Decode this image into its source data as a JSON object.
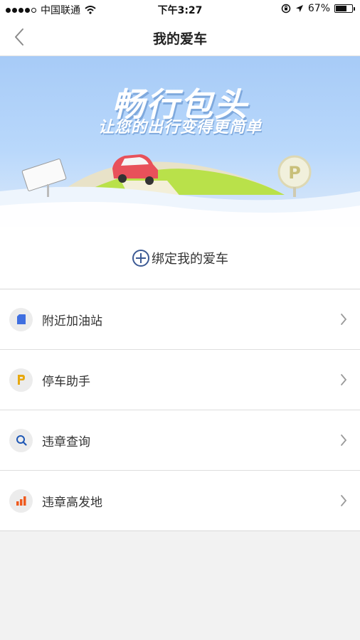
{
  "status_bar": {
    "carrier": "中国联通",
    "time": "下午3:27",
    "battery": "67%",
    "battery_level": 0.67
  },
  "nav": {
    "title": "我的爱车",
    "back_icon": "chevron-left-icon"
  },
  "banner": {
    "title": "畅行包头",
    "subtitle": "让您的出行变得更简单"
  },
  "bind": {
    "label": "绑定我的爱车",
    "icon": "plus-circle-icon"
  },
  "menu": {
    "items": [
      {
        "label": "附近加油站",
        "icon": "fuel-icon",
        "color": "#3f6fe0"
      },
      {
        "label": "停车助手",
        "icon": "parking-icon",
        "color": "#e7a80f"
      },
      {
        "label": "违章查询",
        "icon": "search-icon",
        "color": "#1f58b5"
      },
      {
        "label": "违章高发地",
        "icon": "bar-chart-icon",
        "color": "#ef5a1e"
      }
    ]
  }
}
